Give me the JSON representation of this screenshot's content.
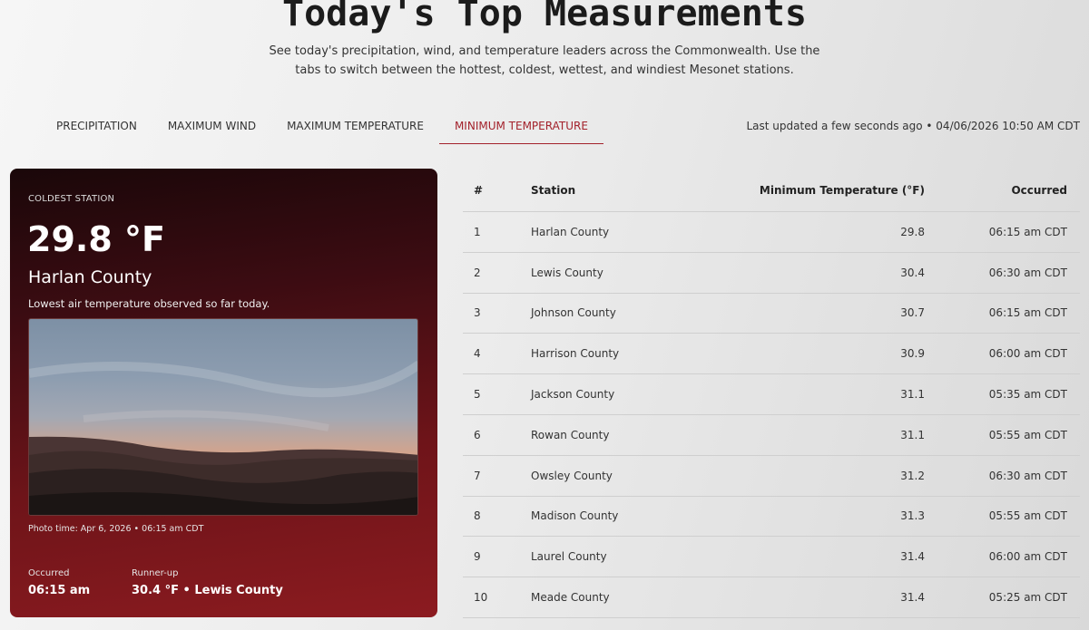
{
  "header": {
    "title": "Today's Top Measurements",
    "subtitle": "See today's precipitation, wind, and temperature leaders across the Commonwealth. Use the tabs to switch between the hottest, coldest, wettest, and windiest Mesonet stations."
  },
  "tabs": [
    {
      "label": "PRECIPITATION"
    },
    {
      "label": "MAXIMUM WIND"
    },
    {
      "label": "MAXIMUM TEMPERATURE"
    },
    {
      "label": "MINIMUM TEMPERATURE",
      "active": true
    }
  ],
  "updated": "Last updated a few seconds ago • 04/06/2026 10:50 AM CDT",
  "card": {
    "eyebrow": "COLDEST STATION",
    "temp": "29.8 °F",
    "station": "Harlan County",
    "description": "Lowest air temperature observed so far today.",
    "photo_caption": "Photo time: Apr 6, 2026 • 06:15 am CDT",
    "occurred_label": "Occurred",
    "occurred_value": "06:15 am",
    "runnerup_label": "Runner-up",
    "runnerup_value": "30.4 °F • Lewis County"
  },
  "table": {
    "headers": [
      "#",
      "Station",
      "Minimum Temperature (°F)",
      "Occurred"
    ],
    "rows": [
      {
        "rank": "1",
        "station": "Harlan County",
        "value": "29.8",
        "occurred": "06:15 am CDT"
      },
      {
        "rank": "2",
        "station": "Lewis County",
        "value": "30.4",
        "occurred": "06:30 am CDT"
      },
      {
        "rank": "3",
        "station": "Johnson County",
        "value": "30.7",
        "occurred": "06:15 am CDT"
      },
      {
        "rank": "4",
        "station": "Harrison County",
        "value": "30.9",
        "occurred": "06:00 am CDT"
      },
      {
        "rank": "5",
        "station": "Jackson County",
        "value": "31.1",
        "occurred": "05:35 am CDT"
      },
      {
        "rank": "6",
        "station": "Rowan County",
        "value": "31.1",
        "occurred": "05:55 am CDT"
      },
      {
        "rank": "7",
        "station": "Owsley County",
        "value": "31.2",
        "occurred": "06:30 am CDT"
      },
      {
        "rank": "8",
        "station": "Madison County",
        "value": "31.3",
        "occurred": "05:55 am CDT"
      },
      {
        "rank": "9",
        "station": "Laurel County",
        "value": "31.4",
        "occurred": "06:00 am CDT"
      },
      {
        "rank": "10",
        "station": "Meade County",
        "value": "31.4",
        "occurred": "05:25 am CDT"
      }
    ]
  },
  "colors": {
    "accent": "#a3212b",
    "card_dark": "#1a0709",
    "card_red": "#8c1b20"
  }
}
